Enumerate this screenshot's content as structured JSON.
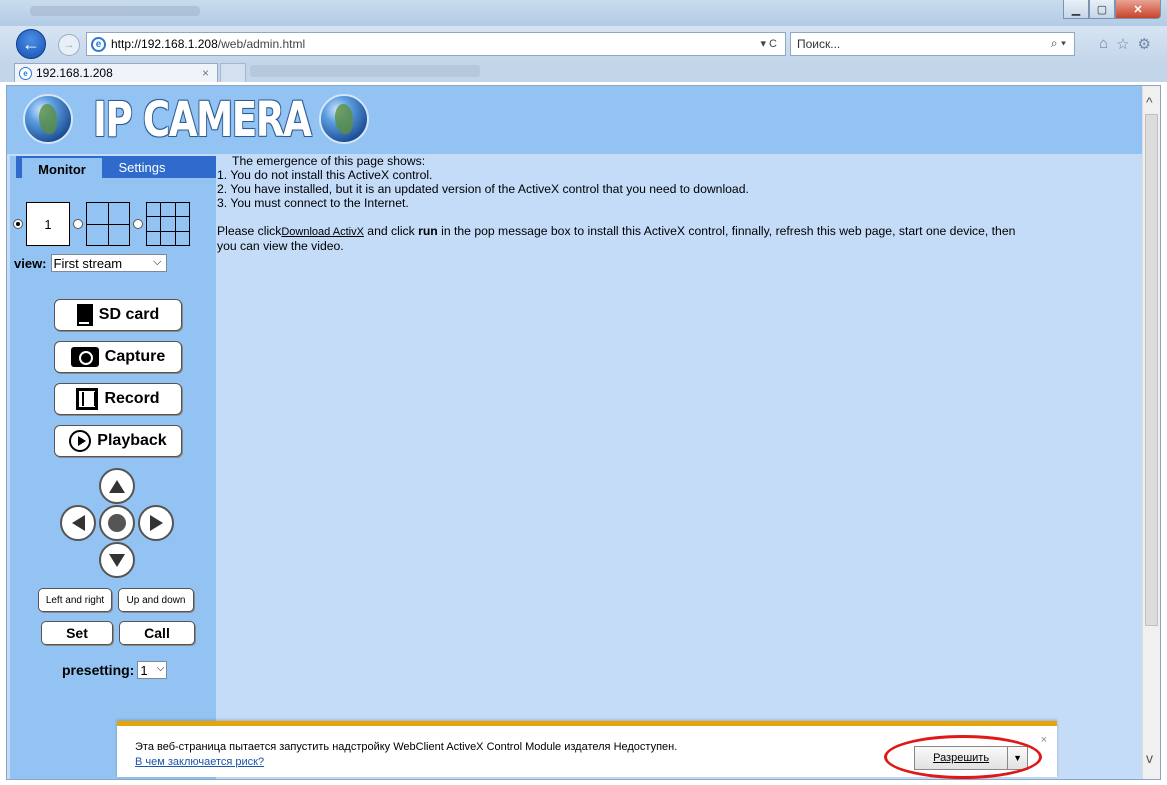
{
  "browser": {
    "url_host": "http://192.168.1.208",
    "url_path": "/web/admin.html",
    "search_placeholder": "Поиск...",
    "tab_title": "192.168.1.208",
    "tab_close": "×",
    "url_refresh": "▾ C",
    "search_icon": "⌕ ▾",
    "toolbar_icons": [
      "home-icon",
      "star-icon",
      "gear-icon"
    ]
  },
  "page": {
    "logo_text": "IP CAMERA",
    "tabs": {
      "monitor": "Monitor",
      "settings": "Settings"
    },
    "split_one_label": "1",
    "view_label": "view:",
    "view_value": "First stream",
    "buttons": {
      "sd_card": "SD card",
      "capture": "Capture",
      "record": "Record",
      "playback": "Playback",
      "left_right": "Left and right",
      "up_down": "Up and down",
      "set": "Set",
      "call": "Call"
    },
    "presetting_label": "presetting:",
    "presetting_value": "1",
    "content": {
      "line_intro": "The emergence of this page shows:",
      "line1": "1. You do not install this ActiveX control.",
      "line2": "2. You have installed, but it is an updated version of the ActiveX control that you need to download.",
      "line3": "3. You must connect to the Internet.",
      "please_prefix": "Please click",
      "download_link": "Download ActivX",
      "and_click": " and click ",
      "run": "run",
      "please_suffix": " in the pop message box to install this ActiveX control, finnally, refresh this web page, start one device, then",
      "line_last": "you can view the video."
    }
  },
  "notification": {
    "message": "Эта веб-страница пытается запустить надстройку WebClient ActiveX Control Module издателя Недоступен.",
    "risk_link": "В чем заключается риск?",
    "allow_button": "Разрешить",
    "close": "×"
  },
  "colors": {
    "page_bg": "#c4dcf8",
    "sidebar_bg": "#93c3f2",
    "tab_active_bg": "#2f6bcd",
    "notification_accent": "#e5a50a",
    "highlight_ring": "#e01818"
  }
}
